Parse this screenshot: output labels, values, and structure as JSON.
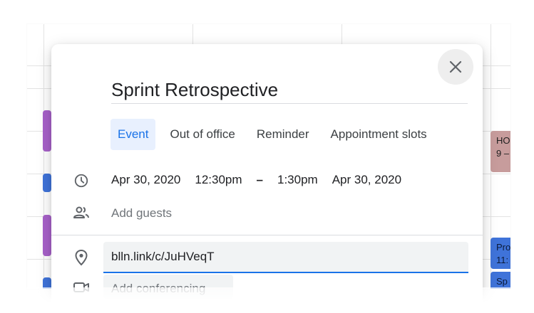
{
  "dialog": {
    "title": "Sprint Retrospective",
    "close_icon": "close-icon"
  },
  "tabs": [
    {
      "label": "Event",
      "active": true
    },
    {
      "label": "Out of office",
      "active": false
    },
    {
      "label": "Reminder",
      "active": false
    },
    {
      "label": "Appointment slots",
      "active": false
    }
  ],
  "datetime": {
    "icon": "clock-icon",
    "start_date": "Apr 30, 2020",
    "start_time": "12:30pm",
    "separator": "–",
    "end_time": "1:30pm",
    "end_date": "Apr 30, 2020"
  },
  "guests": {
    "icon": "people-icon",
    "placeholder": "Add guests"
  },
  "location": {
    "icon": "location-pin-icon",
    "value": "blln.link/c/JuHVeqT"
  },
  "conferencing": {
    "icon": "video-icon",
    "label": "Add conferencing"
  },
  "background_events": [
    {
      "line1": "HO",
      "line2": "9 –",
      "color": "#c79c9c"
    },
    {
      "line1": "Pro",
      "line2": "11:",
      "color": "#3f73d9"
    },
    {
      "line1": "Sp",
      "line2": "",
      "color": "#3f73d9"
    }
  ],
  "colors": {
    "accent": "#1a73e8",
    "active_tab_bg": "#e8f0fe",
    "event_purple": "#a761c9",
    "event_blue": "#3f73d9"
  }
}
